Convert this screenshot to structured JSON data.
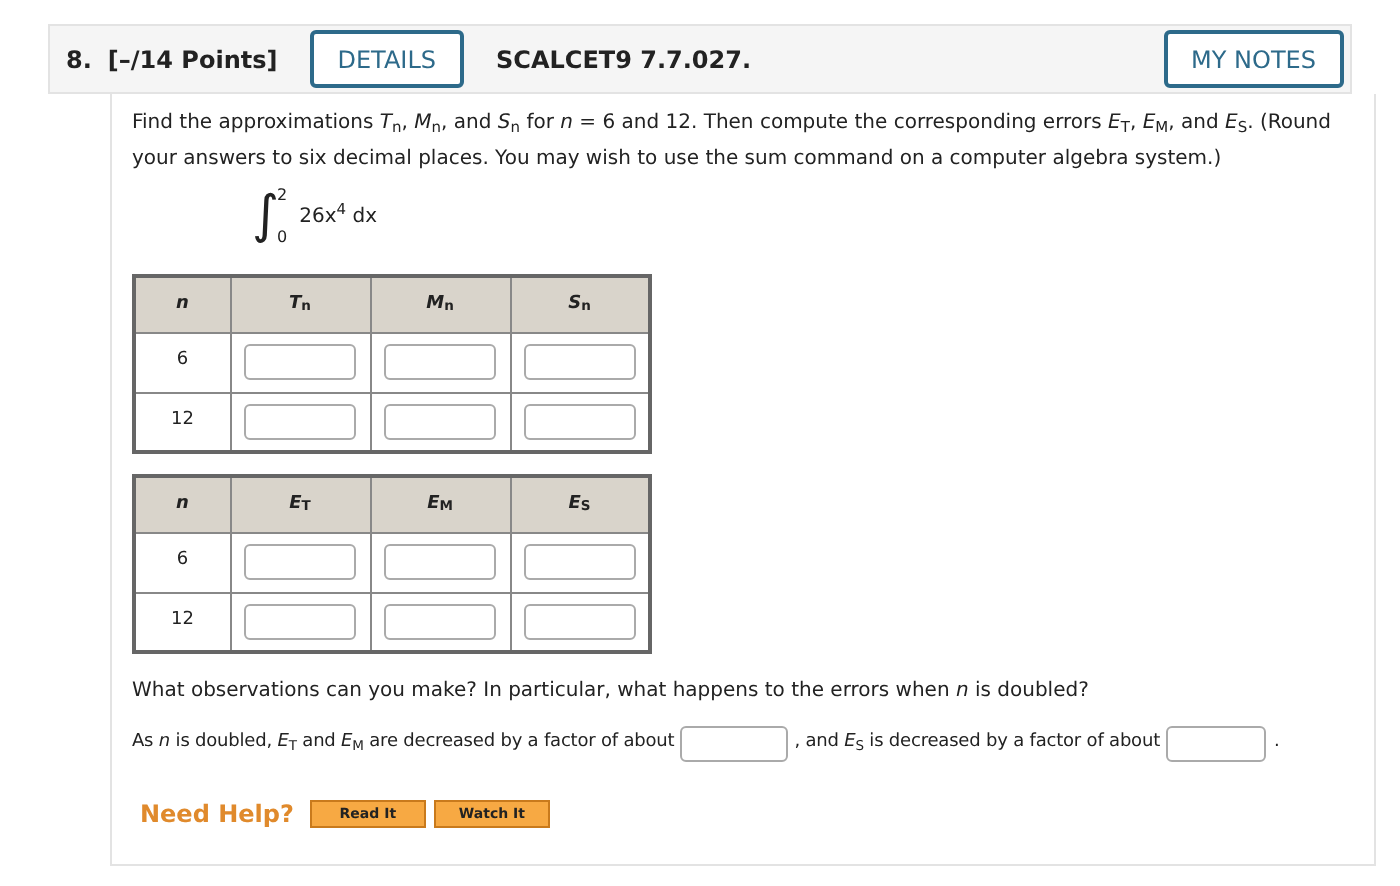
{
  "header": {
    "number": "8.",
    "points": "[–/14 Points]",
    "details_button": "DETAILS",
    "problem_id": "SCALCET9 7.7.027.",
    "notes_button": "MY NOTES"
  },
  "instructions": "Find the approximations *T*$_{n}$, *M*$_{n}$, and *S*$_{n}$ for *n* = 6 and 12. Then compute the corresponding errors *E*$_{T}$, *E*$_{M}$, and *E*$_{S}$. (Round your answers to six decimal places. You may wish to use the sum command on a computer algebra system.)",
  "integral": {
    "sign": "∫",
    "upper": "2",
    "lower": "0",
    "integrand": "26x$^{4}$ dx"
  },
  "tables": [
    {
      "columns": [
        "*n*",
        "*T*$_{n}$",
        "*M*$_{n}$",
        "*S*$_{n}$"
      ],
      "rows": [
        "6",
        "12"
      ]
    },
    {
      "columns": [
        "*n*",
        "*E*$_{T}$",
        "*E*$_{M}$",
        "*E*$_{S}$"
      ],
      "rows": [
        "6",
        "12"
      ]
    }
  ],
  "question": "What observations can you make? In particular, what happens to the errors when *n* is doubled?",
  "answer_parts": [
    "As *n* is doubled, *E*$_{T}$ and *E*$_{M}$ are decreased by a factor of about",
    ", and *E*$_{S}$ is decreased by a factor of about",
    "."
  ],
  "help": {
    "label": "Need Help?",
    "buttons": [
      "Read It",
      "Watch It"
    ]
  }
}
